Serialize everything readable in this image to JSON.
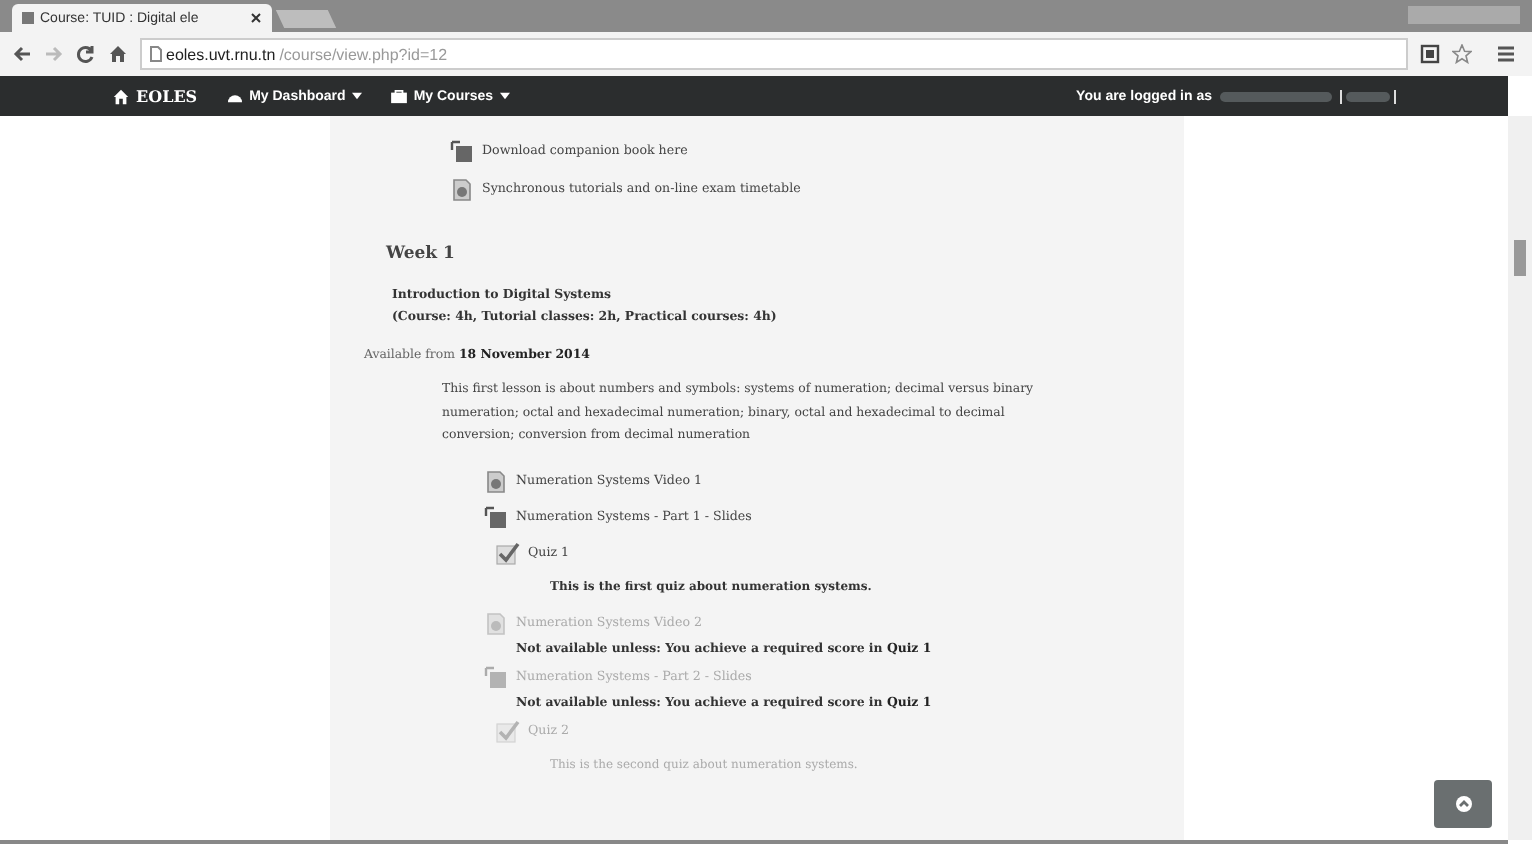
{
  "browser": {
    "tab": {
      "title": "Course: TUID : Digital ele"
    },
    "address": {
      "host": "eoles.uvt.rnu.tn",
      "path": "/course/view.php?id=12"
    }
  },
  "navbar": {
    "brand": "EOLES",
    "menus": [
      {
        "label": "My Dashboard"
      },
      {
        "label": "My Courses"
      }
    ],
    "login_text": "You are logged in as"
  },
  "resources": [
    {
      "kind": "slides",
      "label": "Download companion book here",
      "disabled": false
    },
    {
      "kind": "file",
      "label": "Synchronous tutorials and on-line exam timetable",
      "disabled": false
    }
  ],
  "section": {
    "title": "Week 1",
    "summary": [
      "Introduction to Digital Systems",
      "(Course: 4h, Tutorial classes: 2h, Practical courses: 4h)"
    ],
    "availability": "Available from **18 November 2014**",
    "description": "This first lesson is about numbers and symbols: systems of numeration; decimal versus binary numeration; octal and hexadecimal numeration; binary, octal and hexadecimal to decimal conversion; conversion from decimal numeration",
    "activities": [
      {
        "kind": "file",
        "label": "Numeration Systems Video 1",
        "disabled": false
      },
      {
        "kind": "slides",
        "label": "Numeration Systems - Part 1 - Slides",
        "disabled": false,
        "children": [
          {
            "kind": "quiz",
            "label": "Quiz 1",
            "disabled": false,
            "description": "This is the first quiz about numeration systems."
          }
        ]
      },
      {
        "kind": "file",
        "label": "Numeration Systems Video 2",
        "disabled": true,
        "restriction": "Not available unless: You achieve a required score in **Quiz 1**"
      },
      {
        "kind": "slides",
        "label": "Numeration Systems - Part 2 - Slides",
        "disabled": true,
        "restriction": "Not available unless: You achieve a required score in **Quiz 1**",
        "children": [
          {
            "kind": "quiz",
            "label": "Quiz 2",
            "disabled": true,
            "description": "This is the second quiz about numeration systems."
          }
        ]
      }
    ]
  }
}
